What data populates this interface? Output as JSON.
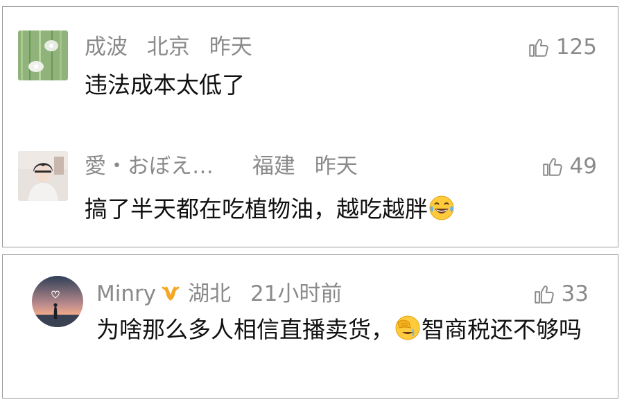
{
  "comments_top": [
    {
      "name": "成波",
      "location": "北京",
      "time": "昨天",
      "likes": "125",
      "text": "违法成本太低了"
    },
    {
      "name": "愛・おぼえ…",
      "location": "福建",
      "time": "昨天",
      "likes": "49",
      "text": "搞了半天都在吃植物油，越吃越胖",
      "emoji": "laughing-tears-emoji"
    }
  ],
  "comment_bottom": {
    "name": "Minry",
    "badge": "vip-badge-icon",
    "location": "湖北",
    "time": "21小时前",
    "likes": "33",
    "text_before_emoji": "为啥那么多人相信直播卖货，",
    "emoji": "facepalm-emoji",
    "text_after_emoji": "智商税还不够吗"
  },
  "colors": {
    "meta_text": "#8a8a8a",
    "body_text": "#111111",
    "border": "#9b9b9b",
    "badge": "#f5a623"
  }
}
